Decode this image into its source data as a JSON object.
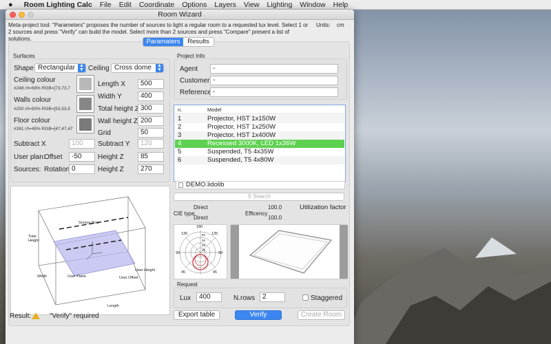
{
  "menubar": {
    "apple": "",
    "app": "Room Lighting Calc",
    "items": [
      "File",
      "Edit",
      "Coordinate",
      "Options",
      "Layers",
      "View",
      "Lighting",
      "Window",
      "Help"
    ]
  },
  "window": {
    "title": "Room Wizard"
  },
  "description": "Meta-project tool: \"Parameters\" proposes the number of sources to light a regular room to a requested lux level. Select 1 or 2 sources and press \"Verify\" can build the model. Select more than 2 sources and press \"Compare\" present a list of solutions.",
  "units": {
    "label": "Units:",
    "value": "cm"
  },
  "tabs": [
    "Paramaters",
    "Results"
  ],
  "surfaces": {
    "title": "Surfaces",
    "shape_label": "Shape",
    "shape_value": "Rectangular",
    "ceiling_label": "Ceiling",
    "ceiling_value": "Cross dome",
    "ceiling_colour": {
      "label": "Ceiling colour",
      "info": "#248 r/t=69% RGB=[73,73,7"
    },
    "walls_colour": {
      "label": "Walls colour",
      "info": "#250 r/t=50% RGB=[53,53,5"
    },
    "floor_colour": {
      "label": "Floor colour",
      "info": "#261 r/t=45% RGB=[47,47,47"
    },
    "length_x": {
      "label": "Length X",
      "value": "500"
    },
    "width_y": {
      "label": "Width Y",
      "value": "400"
    },
    "total_height": {
      "label": "Total height Z",
      "value": "300"
    },
    "wall_height": {
      "label": "Wall height Z",
      "value": "200"
    },
    "grid": {
      "label": "Grid",
      "value": "50"
    },
    "subtract_x": {
      "label": "Subtract X",
      "value": "100"
    },
    "subtract_y": {
      "label": "Subtract Y",
      "value": "120"
    },
    "user_plan": {
      "label": "User plan:",
      "offset_label": "Offset",
      "offset_value": "-50",
      "height_label": "Height Z",
      "height_value": "85"
    },
    "sources": {
      "label": "Sources:",
      "rotation_label": "Rotation",
      "rotation_value": "0",
      "height_label": "Height Z",
      "height_value": "270"
    }
  },
  "room_diagram": {
    "source_row": "Source Row",
    "total_height": "Total\nHeight",
    "width": "Width",
    "user_plane": "User Plane",
    "user_offset": "User Offset",
    "user_height": "User Height",
    "length": "Length"
  },
  "project_info": {
    "title": "Project Info",
    "agent": {
      "label": "Agent",
      "value": "-"
    },
    "customer": {
      "label": "Customer",
      "value": "-"
    },
    "reference": {
      "label": "Reference",
      "value": "-"
    }
  },
  "sources_table": {
    "headers": [
      "n.",
      "Model"
    ],
    "rows": [
      {
        "n": "1",
        "model": "Projector, HST 1x150W"
      },
      {
        "n": "2",
        "model": "Projector, HST 1x250W"
      },
      {
        "n": "3",
        "model": "Projector, HST 1x400W"
      },
      {
        "n": "4",
        "model": "Recessed 3000K, LED 1x36W"
      },
      {
        "n": "5",
        "model": "Suspended, T5  4x35W"
      },
      {
        "n": "6",
        "model": "Suspended, T5  4x80W"
      }
    ],
    "selected_index": 3
  },
  "library_file": "DEMO.lidolib",
  "search_placeholder": "Search",
  "cie": {
    "label": "CIE type",
    "value1": "Direct",
    "value2": "Direct"
  },
  "utilization": {
    "value": "100.0",
    "label": "Utilization factor"
  },
  "efficiency": {
    "label": "Efficency",
    "value": "100.0"
  },
  "polar": {
    "labels": [
      "180",
      "135",
      "135",
      "90",
      "90",
      "45",
      "45"
    ],
    "rings": [
      "15",
      "30",
      "45",
      "60"
    ]
  },
  "request": {
    "title": "Request",
    "lux_label": "Lux",
    "lux_value": "400",
    "nrows_label": "N.rows",
    "nrows_value": "2",
    "staggered_label": "Staggered"
  },
  "footer": {
    "result_label": "Result:",
    "result_text": "\"Verify\" required",
    "export": "Export table",
    "verify": "Verify",
    "create": "Create Room"
  },
  "colors": {
    "accent": "#3b86f0",
    "selected_row": "#5ed150"
  }
}
